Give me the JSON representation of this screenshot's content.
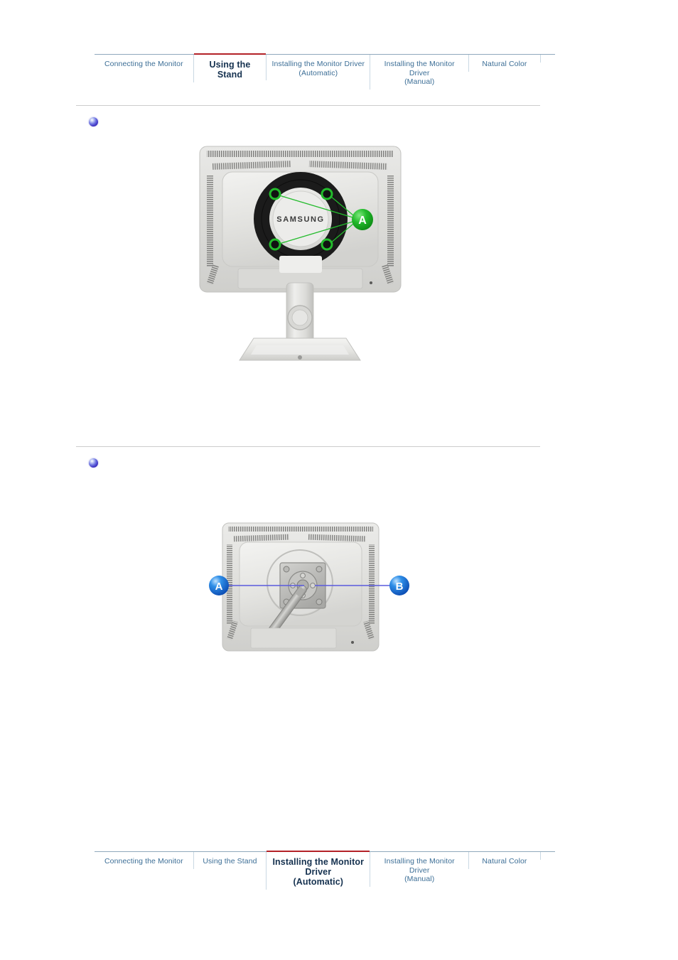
{
  "page": {
    "title": "Using the Stand",
    "accent_red": "#b32127",
    "nav_link_color": "#3c6e96",
    "nav_active_color": "#15314f",
    "divider_color": "#cccccc",
    "bullet_color": "#3c2fbf"
  },
  "nav_top": {
    "active_index": 1,
    "tabs": [
      {
        "label": "Connecting  the Monitor",
        "active": false
      },
      {
        "label": "Using the Stand",
        "active": true
      },
      {
        "label": "Installing the Monitor Driver\n(Automatic)",
        "active": false
      },
      {
        "label": "Installing the Monitor Driver\n(Manual)",
        "active": false
      },
      {
        "label": "Natural Color",
        "active": false
      },
      {
        "label": "",
        "active": false
      }
    ]
  },
  "nav_bottom": {
    "active_index": 2,
    "tabs": [
      {
        "label": "Connecting  the Monitor",
        "active": false
      },
      {
        "label": "Using the Stand",
        "active": false
      },
      {
        "label": "Installing the Monitor Driver\n(Automatic)",
        "active": true
      },
      {
        "label": "Installing the Monitor Driver\n(Manual)",
        "active": false
      },
      {
        "label": "Natural Color",
        "active": false
      },
      {
        "label": "",
        "active": false
      }
    ]
  },
  "sections": [
    {
      "bullet": "blue-sphere-bullet",
      "heading": "",
      "figure": {
        "name": "monitor-rear-vesa-holes",
        "brand_text": "SAMSUNG",
        "callouts": [
          {
            "label": "A",
            "color": "#1faa29"
          }
        ]
      }
    },
    {
      "bullet": "blue-sphere-bullet",
      "heading": "",
      "figure": {
        "name": "monitor-rear-vesa-bracket-screwdriver",
        "brand_text": "",
        "callouts": [
          {
            "label": "A",
            "color": "#1b72d8"
          },
          {
            "label": "B",
            "color": "#1b72d8"
          }
        ]
      }
    }
  ]
}
